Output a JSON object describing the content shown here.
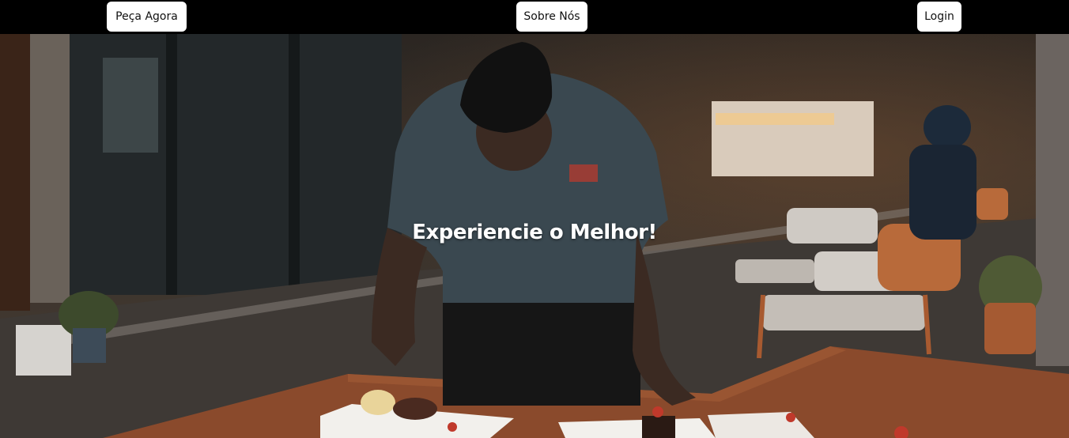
{
  "nav": {
    "order_label": "Peça Agora",
    "about_label": "Sobre Nós",
    "login_label": "Login"
  },
  "hero": {
    "title": "Experiencie o Melhor!",
    "image_subject": "chef plating dishes at a restaurant table"
  },
  "colors": {
    "topbar": "#000000",
    "button_bg": "#ffffff",
    "button_text": "#111111",
    "hero_text": "#ffffff",
    "table_wood": "#8a4a2c"
  }
}
